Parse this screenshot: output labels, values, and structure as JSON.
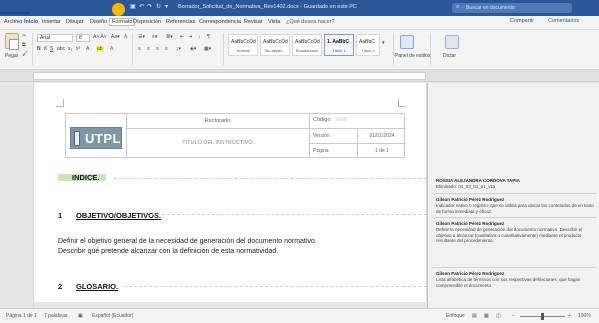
{
  "window": {
    "title": "Borrador_Solicitud_de_Normativa_Rev1402.docx - Guardado en este PC",
    "search_placeholder": "Buscar en documento",
    "accent": "#2b579a",
    "quick_access": [
      "save-icon",
      "undo-icon",
      "redo-icon",
      "refresh-icon",
      "customize-icon"
    ]
  },
  "menu": {
    "tabs": [
      "Archivo",
      "Inicio",
      "Insertar",
      "Dibujar",
      "Diseño",
      "Formato",
      "Disposición",
      "Referencias",
      "Correspondencia",
      "Revisar",
      "Vista",
      "¿Qué desea hacer?"
    ],
    "active": "Inicio",
    "share": "Compartir",
    "comments": "Comentarios"
  },
  "ribbon": {
    "paste_label": "Pegar",
    "font_name": "Arial",
    "font_size": "8",
    "styles": [
      {
        "preview": "AaBbCcDd",
        "name": "Normal"
      },
      {
        "preview": "AaBbCcDd",
        "name": "Sin espac..."
      },
      {
        "preview": "AaBbCcDd",
        "name": "Encabezado"
      },
      {
        "preview": "1. AaBbC",
        "name": "Título 1"
      },
      {
        "preview": "AaBbC",
        "name": "Título 2"
      }
    ],
    "styles_pane_label": "Panel de estilos",
    "dictate_label": "Dictar"
  },
  "document": {
    "header": {
      "logo_text": "UTPL",
      "col_title": "Rectorado",
      "doc_title": "TÍTULO DEL INSTRUCTIVO",
      "code_label": "Código:",
      "version_label": "Versión",
      "version_date_label": "Fecha de",
      "version_date": "01/01/2024",
      "page_label": "Página",
      "page_value": "1 de 1"
    },
    "index_title": "INDICE.",
    "section1_num": "1",
    "section1_title": "OBJETIVO/OBJETIVOS.",
    "section1_body_1": "Definir el objetivo general de la necesidad de generación del documento normativo.",
    "section1_body_2": "Describir qué pretende alcanzar con la definición de esta normatividad.",
    "section2_num": "2",
    "section2_title": "GLOSARIO."
  },
  "comments": [
    {
      "author": "ROSSIA ALEJANDRA CORDOVA TAPIA",
      "text": "Eliminado: 01_03_01_n1_v1s"
    },
    {
      "author": "Gilson Patricio Pérez Rodríguez",
      "text": "Indicador nativo o registro, que se utiliza para ubicar los contenidos de un texto de forma inmediata y eficaz."
    },
    {
      "author": "Gilson Patricio Pérez Rodríguez",
      "text": "Definir la necesidad de generación del documento normativo. Describir el objetivo a alcanzar (cualitativo o cuantitativamente) mediante el producto resultante del procedimiento."
    },
    {
      "author": "Gilson Patricio Pérez Rodríguez",
      "text": "Lista alfabética de términos con sus respectivas definiciones, que hagan comprensible el documento."
    }
  ],
  "status": {
    "page": "Página 1 de 1",
    "words": "7 palabras",
    "language": "Español (Ecuador)",
    "focus": "Enfoque",
    "zoom": "100%"
  }
}
